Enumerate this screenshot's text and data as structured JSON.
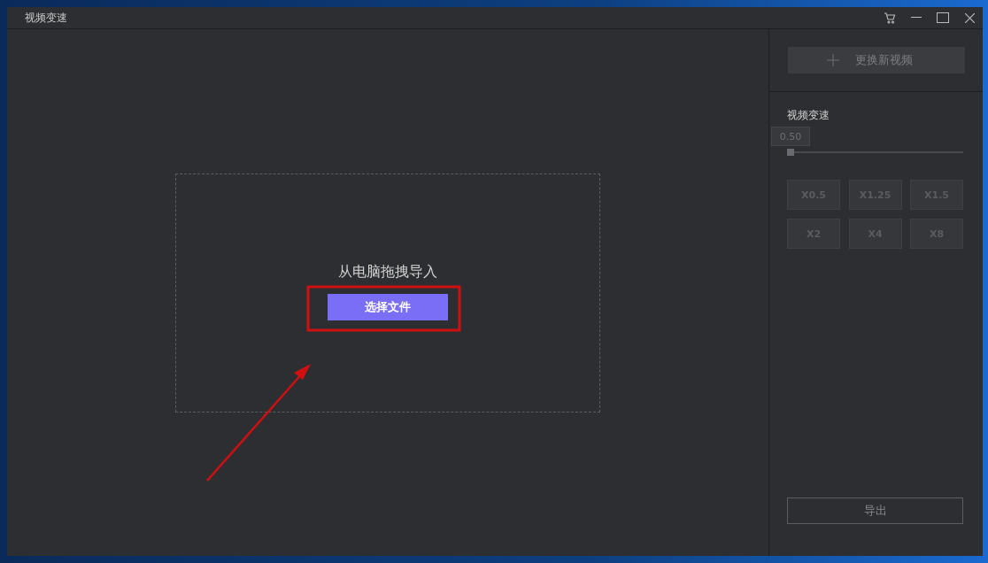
{
  "window": {
    "title": "视频变速"
  },
  "drop_zone": {
    "prompt": "从电脑拖拽导入",
    "button": "选择文件"
  },
  "sidebar": {
    "replace_button": "更换新视频",
    "speed": {
      "label": "视频变速",
      "value": "0.50",
      "level": 0
    },
    "presets": [
      "X0.5",
      "X1.25",
      "X1.5",
      "X2",
      "X4",
      "X8"
    ],
    "export_button": "导出"
  }
}
